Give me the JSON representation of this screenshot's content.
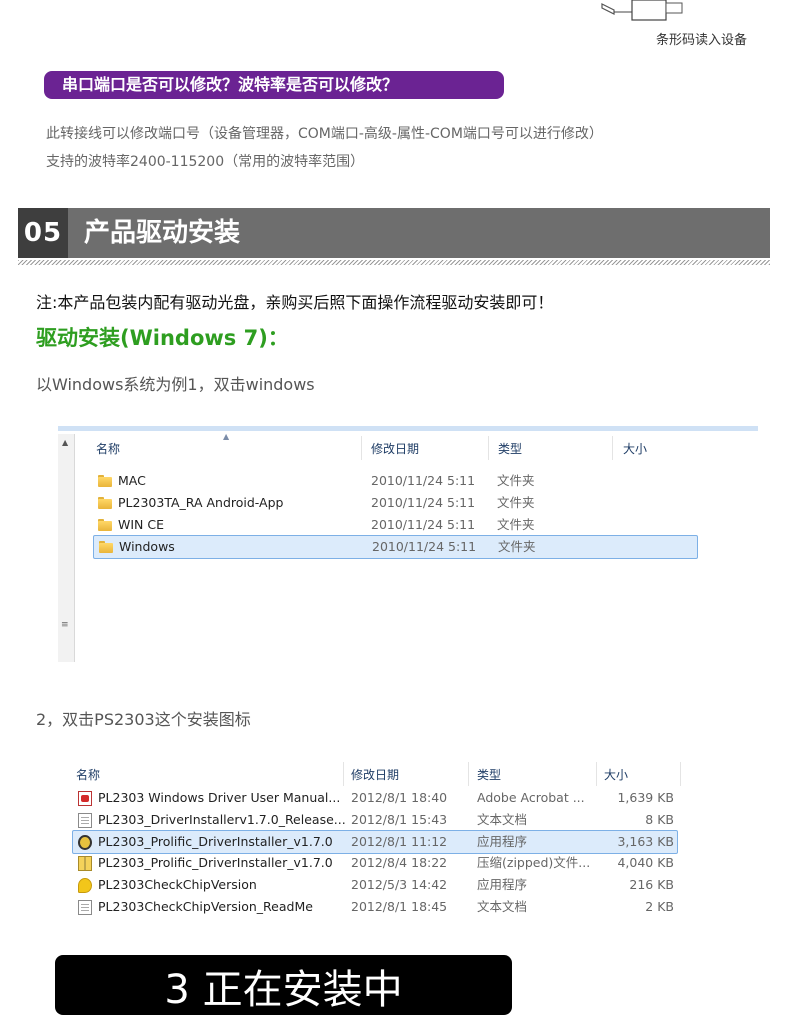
{
  "top": {
    "device_caption": "条形码读入设备",
    "question_banner": "串口端口是否可以修改？波特率是否可以修改？",
    "line1": "此转接线可以修改端口号（设备管理器，COM端口-高级-属性-COM端口号可以进行修改）",
    "line2": "支持的波特率2400-115200（常用的波特率范围）"
  },
  "section": {
    "number": "05",
    "title": "产品驱动安装"
  },
  "content": {
    "note": "注:本产品包装内配有驱动光盘，亲购买后照下面操作流程驱动安装即可！",
    "subtitle": "驱动安装(Windows 7)：",
    "step1": "以Windows系统为例1，双击windows",
    "step2": "2，双击PS2303这个安装图标",
    "step3_banner": "3 正在安装中"
  },
  "explorer1": {
    "headers": {
      "name": "名称",
      "date": "修改日期",
      "type": "类型",
      "size": "大小"
    },
    "rows": [
      {
        "name": "MAC",
        "date": "2010/11/24 5:11",
        "type": "文件夹",
        "icon": "folder-icon"
      },
      {
        "name": "PL2303TA_RA Android-App",
        "date": "2010/11/24 5:11",
        "type": "文件夹",
        "icon": "folder-icon"
      },
      {
        "name": "WIN CE",
        "date": "2010/11/24 5:11",
        "type": "文件夹",
        "icon": "folder-icon"
      },
      {
        "name": "Windows",
        "date": "2010/11/24 5:11",
        "type": "文件夹",
        "icon": "folder-icon",
        "selected": true
      }
    ]
  },
  "explorer2": {
    "headers": {
      "name": "名称",
      "date": "修改日期",
      "type": "类型",
      "size": "大小"
    },
    "rows": [
      {
        "name": "PL2303 Windows Driver User Manual...",
        "date": "2012/8/1 18:40",
        "type": "Adobe Acrobat ...",
        "size": "1,639 KB",
        "icon": "pdf-icon"
      },
      {
        "name": "PL2303_DriverInstallerv1.7.0_Release...",
        "date": "2012/8/1 15:43",
        "type": "文本文档",
        "size": "8 KB",
        "icon": "text-document-icon"
      },
      {
        "name": "PL2303_Prolific_DriverInstaller_v1.7.0",
        "date": "2012/8/1 11:12",
        "type": "应用程序",
        "size": "3,163 KB",
        "icon": "installer-icon",
        "selected": true
      },
      {
        "name": "PL2303_Prolific_DriverInstaller_v1.7.0",
        "date": "2012/8/4 18:22",
        "type": "压缩(zipped)文件...",
        "size": "4,040 KB",
        "icon": "zip-icon"
      },
      {
        "name": "PL2303CheckChipVersion",
        "date": "2012/5/3 14:42",
        "type": "应用程序",
        "size": "216 KB",
        "icon": "chip-app-icon"
      },
      {
        "name": "PL2303CheckChipVersion_ReadMe",
        "date": "2012/8/1 18:45",
        "type": "文本文档",
        "size": "2 KB",
        "icon": "text-document-icon"
      }
    ]
  },
  "colors": {
    "banner_purple": "#6b2393",
    "section_gray": "#6e6e6e",
    "section_num_bg": "#3e3e3e",
    "subtitle_green": "#2e9e20",
    "selection_fill": "#dcebfb",
    "selection_border": "#7db0e6"
  }
}
